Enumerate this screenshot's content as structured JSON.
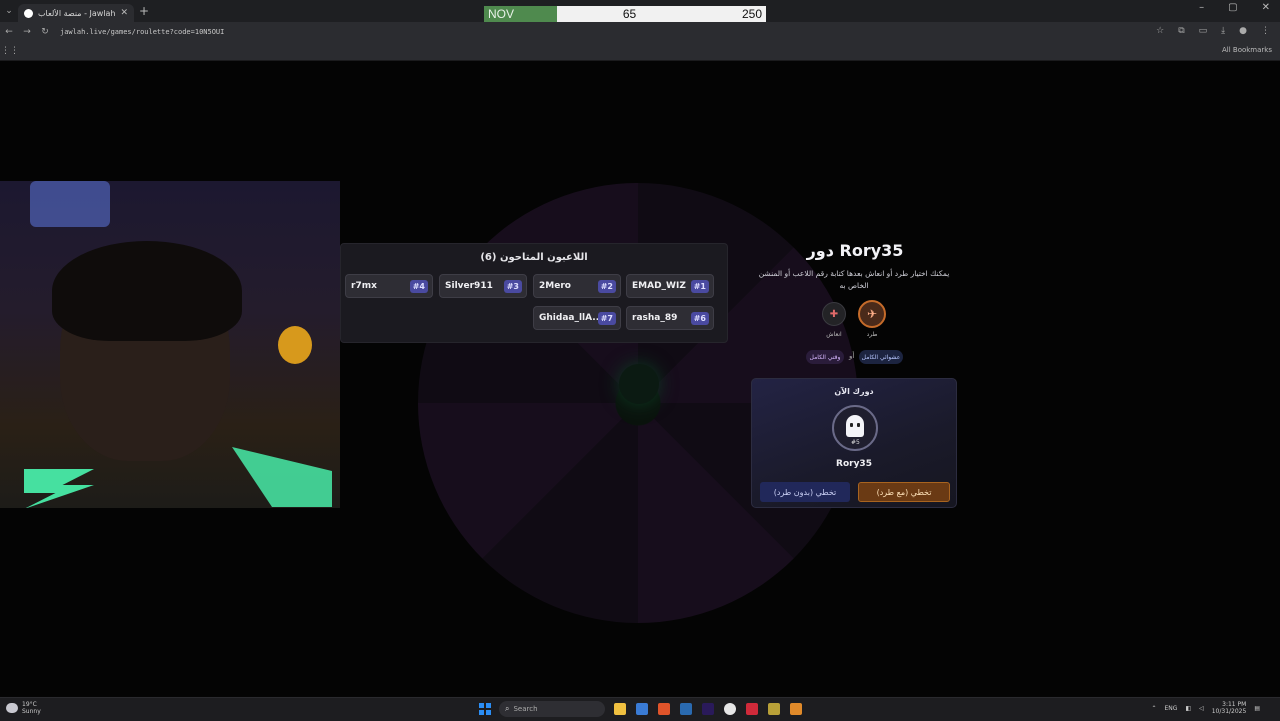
{
  "browser": {
    "tab_title": "منصة الألعاب - Jawlah - جولة",
    "url": "jawlah.live/games/roulette?code=10N5OUI",
    "bookmarks_label": "All Bookmarks"
  },
  "overlay": {
    "label": "NOV",
    "current": "65",
    "max": "250"
  },
  "players_panel": {
    "title": "اللاعبون المتاحون (6)",
    "players": [
      {
        "name": "EMAD_WIZ",
        "rank": "#1"
      },
      {
        "name": "2Mero",
        "rank": "#2"
      },
      {
        "name": "Silver911",
        "rank": "#3"
      },
      {
        "name": "r7mx",
        "rank": "#4"
      },
      {
        "name": "rasha_89",
        "rank": "#6"
      },
      {
        "name": "Ghidaa_llA...",
        "rank": "#7"
      }
    ]
  },
  "turn": {
    "title": "دور Rory35",
    "description": "يمكنك اختيار طرد أو انعاش بعدها كتابة رقم اللاعب أو المنشن الخاص به",
    "kick_label": "طرد",
    "revive_label": "انعاش",
    "pill_left": "وقتي الكامل",
    "pill_sep": "أو",
    "pill_right": "عشوائي الكامل"
  },
  "now_card": {
    "title": "دورك الآن",
    "rank": "#5",
    "player_name": "Rory35",
    "skip_no_kick_label": "تخطي (بدون طرد)",
    "skip_with_kick_label": "تخطي (مع طرد)"
  },
  "taskbar": {
    "weather_temp": "19°C",
    "weather_desc": "Sunny",
    "search_placeholder": "Search",
    "lang": "ENG",
    "time": "3:11 PM",
    "date": "10/31/2025"
  },
  "colors": {
    "overlay_green": "#4f8a4e",
    "rank_badge": "#4a4aa0",
    "pass_button": "#6a3a14",
    "skip_button": "#21285a"
  }
}
